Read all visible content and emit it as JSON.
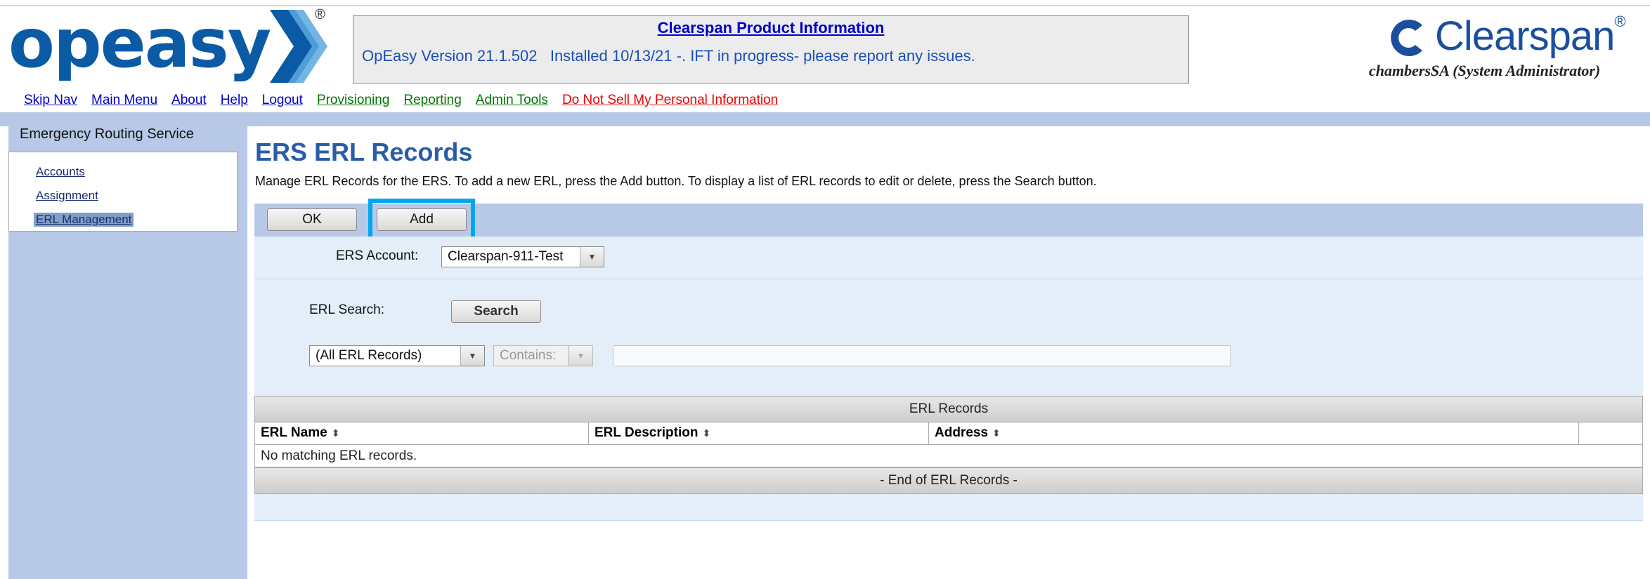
{
  "header": {
    "logo_text": "opeasy",
    "logo_registered": "®",
    "info_title": "Clearspan Product Information",
    "info_message": "OpEasy Version 21.1.502   Installed 10/13/21 -. IFT in progress- please report any issues.",
    "brand_name": "Clearspan",
    "brand_registered": "®",
    "user": "chambersSA (System Administrator)"
  },
  "nav": {
    "skip_nav": "Skip Nav",
    "main_menu": "Main Menu",
    "about": "About",
    "help": "Help",
    "logout": "Logout",
    "provisioning": "Provisioning",
    "reporting": "Reporting",
    "admin_tools": "Admin Tools",
    "do_not_sell": "Do Not Sell My Personal Information"
  },
  "sidebar": {
    "title": "Emergency Routing Service",
    "items": [
      {
        "label": "Accounts",
        "active": false
      },
      {
        "label": "Assignment",
        "active": false
      },
      {
        "label": "ERL Management",
        "active": true
      }
    ]
  },
  "main": {
    "title": "ERS ERL Records",
    "description": "Manage ERL Records for the ERS. To add a new ERL, press the Add button. To display a list of ERL records to edit or delete, press the Search button.",
    "ok_label": "OK",
    "add_label": "Add",
    "ers_account_label": "ERS Account:",
    "ers_account_value": "Clearspan-911-Test",
    "erl_search_label": "ERL Search:",
    "search_label": "Search",
    "filter_value": "(All ERL Records)",
    "match_value": "Contains:",
    "search_text": ""
  },
  "table": {
    "title": "ERL Records",
    "columns": [
      "ERL Name",
      "ERL Description",
      "Address"
    ],
    "empty_message": "No matching ERL records.",
    "footer": "- End of ERL Records -"
  },
  "colors": {
    "brand_blue": "#0a5aa6",
    "title_blue": "#2a5da8",
    "panel_blue": "#b7c9e6",
    "light_blue": "#e3eef8",
    "highlight": "#00a6f0"
  }
}
